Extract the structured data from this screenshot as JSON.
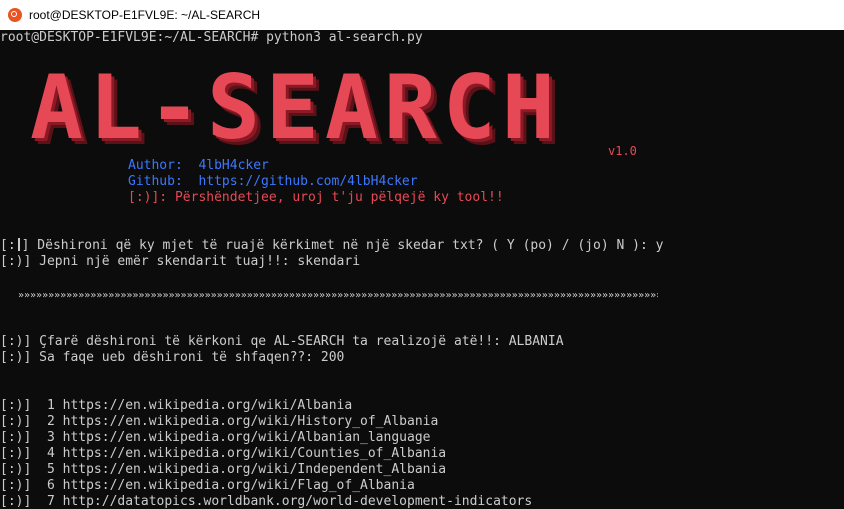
{
  "window": {
    "title": "root@DESKTOP-E1FVL9E: ~/AL-SEARCH"
  },
  "colors": {
    "accent_red": "#e74856",
    "accent_blue": "#3b78ff",
    "text": "#cccccc",
    "background": "#0c0c0c"
  },
  "terminal": {
    "prompt_line": "root@DESKTOP-E1FVL9E:~/AL-SEARCH# python3 al-search.py",
    "banner": "AL-SEARCH",
    "version": "v1.0",
    "author": "Author:  4lbH4cker",
    "github": "Github:  https://github.com/4lbH4cker",
    "greeting": "[:)]: Përshëndetjee, uroj t'ju pëlqejë ky tool!!",
    "q_save_prefix": "[:",
    "q_save_rest": "] Dëshironi që ky mjet të ruajë kërkimet në një skedar txt? ( Y (po) / (jo) N ): y",
    "q_filename": "[:)] Jepni një emër skendarit tuaj!!: skendari",
    "separator": "»»»»»»»»»»»»»»»»»»»»»»»»»»»»»»»»»»»»»»»»»»»»»»»»»»»»»»»»»»»»»»»»»»»»»»»»»»»»»»»»»»»»»»»»»»»»»»»»»»»»»»»»»»»»»»»»»»»»»»»»»»»»»»",
    "q_search": "[:)] Çfarë dëshironi të kërkoni qe AL-SEARCH ta realizojë atë!!: ALBANIA",
    "q_pages": "[:)] Sa faqe ueb dëshironi të shfaqen??: 200",
    "results": [
      "[:)]  1 https://en.wikipedia.org/wiki/Albania",
      "[:)]  2 https://en.wikipedia.org/wiki/History_of_Albania",
      "[:)]  3 https://en.wikipedia.org/wiki/Albanian_language",
      "[:)]  4 https://en.wikipedia.org/wiki/Counties_of_Albania",
      "[:)]  5 https://en.wikipedia.org/wiki/Independent_Albania",
      "[:)]  6 https://en.wikipedia.org/wiki/Flag_of_Albania",
      "[:)]  7 http://datatopics.worldbank.org/world-development-indicators"
    ]
  }
}
